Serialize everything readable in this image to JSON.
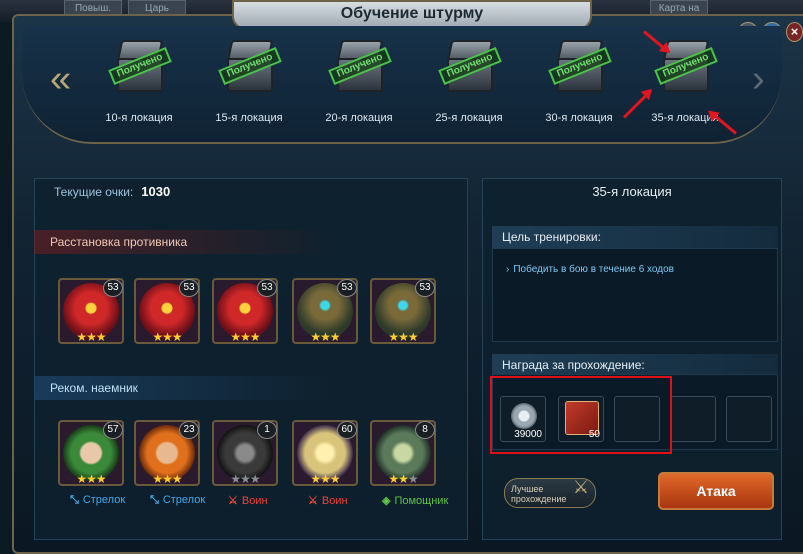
{
  "background": {
    "tabs": [
      "Повыш.",
      "Царь",
      "Карта на"
    ]
  },
  "window": {
    "title": "Обучение штурму",
    "help_label": "?",
    "back_label": "⬅"
  },
  "locations": [
    {
      "label": "10-я локация",
      "stamp": "Получено"
    },
    {
      "label": "15-я локация",
      "stamp": "Получено"
    },
    {
      "label": "20-я локация",
      "stamp": "Получено"
    },
    {
      "label": "25-я локация",
      "stamp": "Получено"
    },
    {
      "label": "30-я локация",
      "stamp": "Получено"
    },
    {
      "label": "35-я локация",
      "stamp": "Получено"
    }
  ],
  "nav": {
    "prev": "«",
    "next": "›"
  },
  "score": {
    "label": "Текущие очки:",
    "value": "1030"
  },
  "enemy": {
    "title": "Расстановка противника",
    "units": [
      {
        "level": "53",
        "stars": 3,
        "kind": "red-beast"
      },
      {
        "level": "53",
        "stars": 3,
        "kind": "red-beast"
      },
      {
        "level": "53",
        "stars": 3,
        "kind": "red-beast"
      },
      {
        "level": "53",
        "stars": 3,
        "kind": "golem"
      },
      {
        "level": "53",
        "stars": 3,
        "kind": "golem"
      }
    ]
  },
  "mercs": {
    "title": "Реком. наемник",
    "units": [
      {
        "level": "57",
        "stars": 3,
        "role": "Стрелок",
        "role_color": "#46a9ea",
        "role_icon": "bow-icon",
        "kind": "green-archer"
      },
      {
        "level": "23",
        "stars": 3,
        "role": "Стрелок",
        "role_color": "#46a9ea",
        "role_icon": "bow-icon",
        "kind": "fire-archer"
      },
      {
        "level": "1",
        "stars": 0,
        "role": "Воин",
        "role_color": "#e8443a",
        "role_icon": "sword-icon",
        "kind": "dark-beast"
      },
      {
        "level": "60",
        "stars": 3,
        "role": "Воин",
        "role_color": "#e8443a",
        "role_icon": "sword-icon",
        "kind": "priest"
      },
      {
        "level": "8",
        "stars": 2,
        "role": "Помощник",
        "role_color": "#5fc24a",
        "role_icon": "support-icon",
        "kind": "stone-healer"
      }
    ]
  },
  "details": {
    "location": "35-я локация",
    "goal_title": "Цель тренировки:",
    "goal_text": "Победить в бою в течение 6 ходов",
    "reward_title": "Награда за прохождение:",
    "rewards": [
      {
        "count": "39000",
        "icon": "coin-icon"
      },
      {
        "count": "50",
        "icon": "book-icon"
      }
    ],
    "best_label": "Лучшее прохождение",
    "attack_label": "Атака"
  },
  "colors": {
    "annotation": "#e3151e",
    "frame_gold": "#6e6248"
  }
}
